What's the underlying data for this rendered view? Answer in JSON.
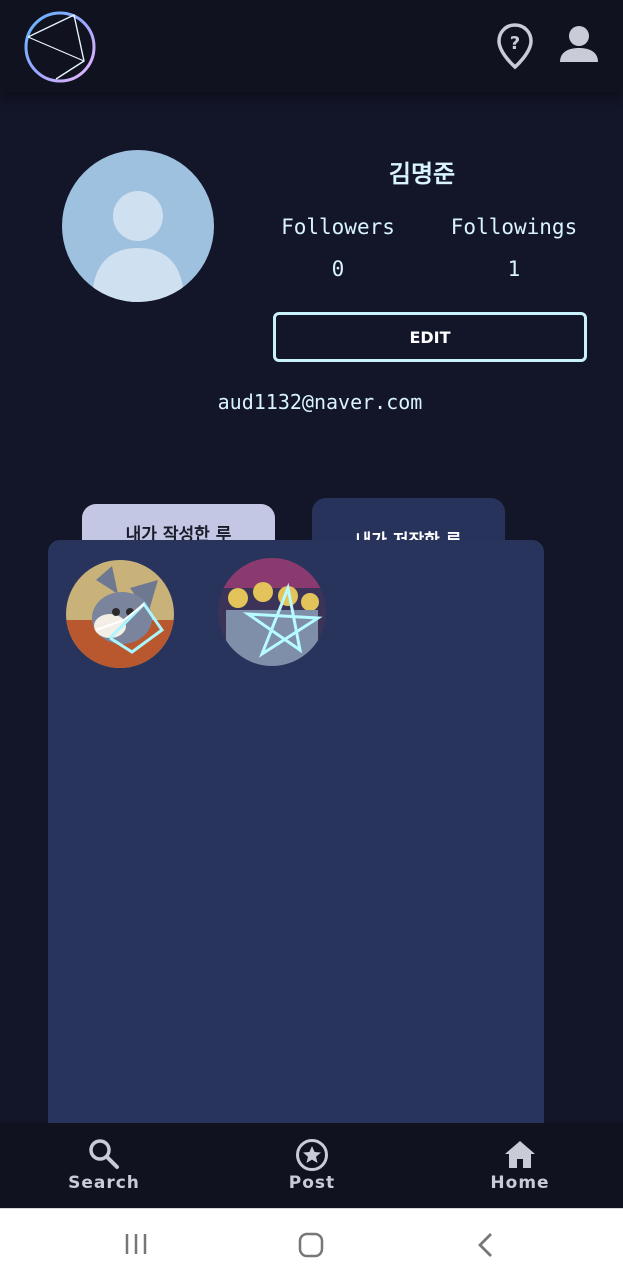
{
  "header": {
    "logo_icon": "constellation-logo-icon",
    "help_icon": "location-help-icon",
    "profile_icon": "person-icon"
  },
  "profile": {
    "name": "김명준",
    "followers_label": "Followers",
    "followers_count": "0",
    "followings_label": "Followings",
    "followings_count": "1",
    "edit_label": "EDIT",
    "email": "aud1132@naver.com"
  },
  "tabs": [
    {
      "label": "내가 작성한 루"
    },
    {
      "label": "내가 저장한 루"
    }
  ],
  "posts": [
    {
      "icon": "cartoon-cat-constellation-thumbnail"
    },
    {
      "icon": "crowd-star-constellation-thumbnail"
    }
  ],
  "bottom_nav": {
    "items": [
      {
        "label": "Search",
        "icon": "search-icon"
      },
      {
        "label": "Post",
        "icon": "star-circle-icon"
      },
      {
        "label": "Home",
        "icon": "home-icon"
      }
    ]
  },
  "system_nav": {
    "items": [
      "recent-apps-icon",
      "home-button-icon",
      "back-icon"
    ]
  },
  "colors": {
    "background": "#131628",
    "panel": "#28345c",
    "accent": "#c9f1fb",
    "tab_active": "#c4c7e4"
  }
}
